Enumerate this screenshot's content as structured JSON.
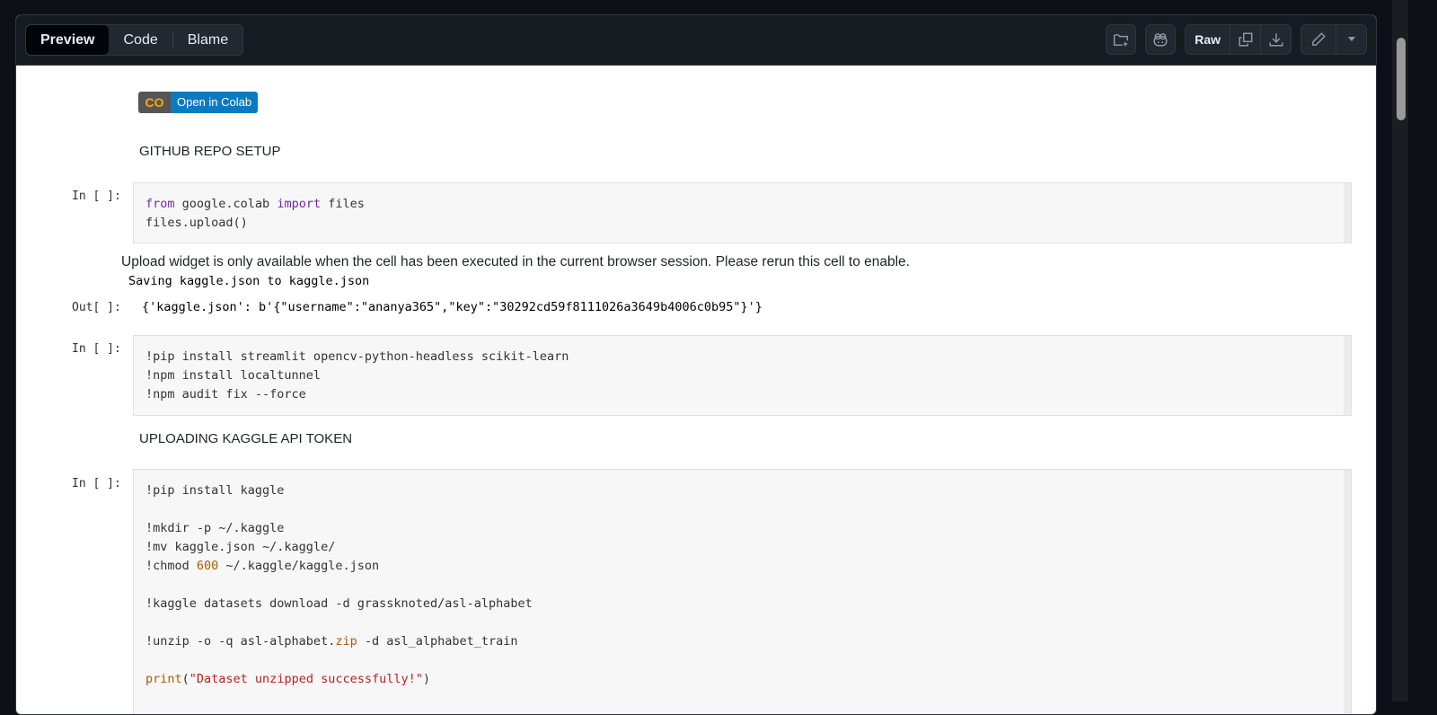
{
  "tabs": [
    "Preview",
    "Code",
    "Blame"
  ],
  "toolbar": {
    "raw": "Raw"
  },
  "badge": {
    "logo": "CO",
    "label": "Open in Colab"
  },
  "md": [
    "GITHUB REPO SETUP",
    "UPLOADING KAGGLE API TOKEN"
  ],
  "prompts": {
    "in": "In [ ]:",
    "out": "Out[ ]:"
  },
  "outputs": {
    "widget": "Upload widget is only available when the cell has been executed in the current browser session. Please rerun this cell to enable.",
    "saving": "Saving kaggle.json to kaggle.json",
    "result": "{'kaggle.json': b'{\"username\":\"ananya365\",\"key\":\"30292cd59f8111026a3649b4006c0b95\"}'}"
  },
  "cells": [
    [
      [
        [
          "from",
          "kw"
        ],
        [
          " google.colab ",
          ""
        ],
        [
          "import",
          "kw"
        ],
        [
          " files",
          ""
        ]
      ],
      [
        [
          "files.upload()",
          ""
        ]
      ]
    ],
    [
      [
        [
          "!pip install streamlit opencv-python-headless scikit-learn",
          ""
        ]
      ],
      [
        [
          "!npm install localtunnel",
          ""
        ]
      ],
      [
        [
          "!npm audit fix --force",
          ""
        ]
      ]
    ],
    [
      [
        [
          "!pip install kaggle",
          ""
        ]
      ],
      [],
      [
        [
          "!mkdir -p ~/.kaggle",
          ""
        ]
      ],
      [
        [
          "!mv kaggle.json ~/.kaggle/",
          ""
        ]
      ],
      [
        [
          "!chmod ",
          ""
        ],
        [
          "600",
          "num"
        ],
        [
          " ~/.kaggle/kaggle.json",
          ""
        ]
      ],
      [],
      [
        [
          "!kaggle datasets download -d grassknoted/asl-alphabet",
          ""
        ]
      ],
      [],
      [
        [
          "!unzip -o -q asl-alphabet.",
          ""
        ],
        [
          "zip",
          "bi"
        ],
        [
          " -d asl_alphabet_train",
          ""
        ]
      ],
      [],
      [
        [
          "print",
          "bi"
        ],
        [
          "(",
          ""
        ],
        [
          "\"Dataset unzipped successfully!\"",
          "str"
        ],
        [
          ")",
          ""
        ]
      ]
    ]
  ]
}
